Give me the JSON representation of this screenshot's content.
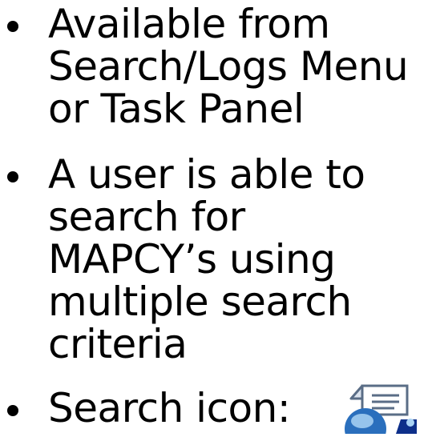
{
  "bullets": [
    {
      "text": "Available from\nSearch/Logs Menu\nor Task Panel"
    },
    {
      "text": "A user is able to\nsearch for\nMAPCY’s using\nmultiple search\ncriteria"
    },
    {
      "text": "Search icon:"
    }
  ],
  "icon": {
    "name": "search-log-icon",
    "colors": {
      "page": "#ffffff",
      "page_outline": "#5a6d86",
      "globe": "#2a6fbd",
      "globe_highlight": "#a9d3f5",
      "accent": "#0d2f8a"
    }
  }
}
